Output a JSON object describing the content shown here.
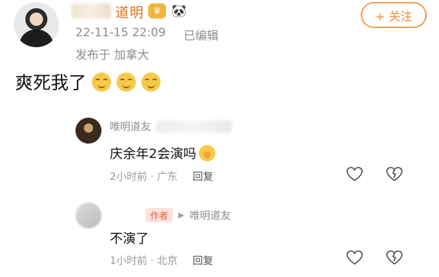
{
  "post": {
    "username": "道明",
    "timestamp": "22-11-15 22:09",
    "edited_label": "已编辑",
    "location": "发布于 加拿大",
    "text": "爽死我了",
    "follow_label": "+ 关注",
    "emoji_icon": "grin-emoji-icon"
  },
  "replies": [
    {
      "name": "唯明道友",
      "text": "庆余年2会演吗",
      "time_location": "2小时前 · 广东",
      "reply_label": "回复"
    },
    {
      "author_tag": "作者",
      "reply_to": "唯明道友",
      "text": "不演了",
      "time_location": "1小时前 · 北京",
      "reply_label": "回复"
    }
  ],
  "colors": {
    "accent": "#ef8d3a",
    "author_tag_bg": "#fde2dd",
    "author_tag_text": "#e85a3a",
    "meta_gray": "#8c8c8c"
  }
}
